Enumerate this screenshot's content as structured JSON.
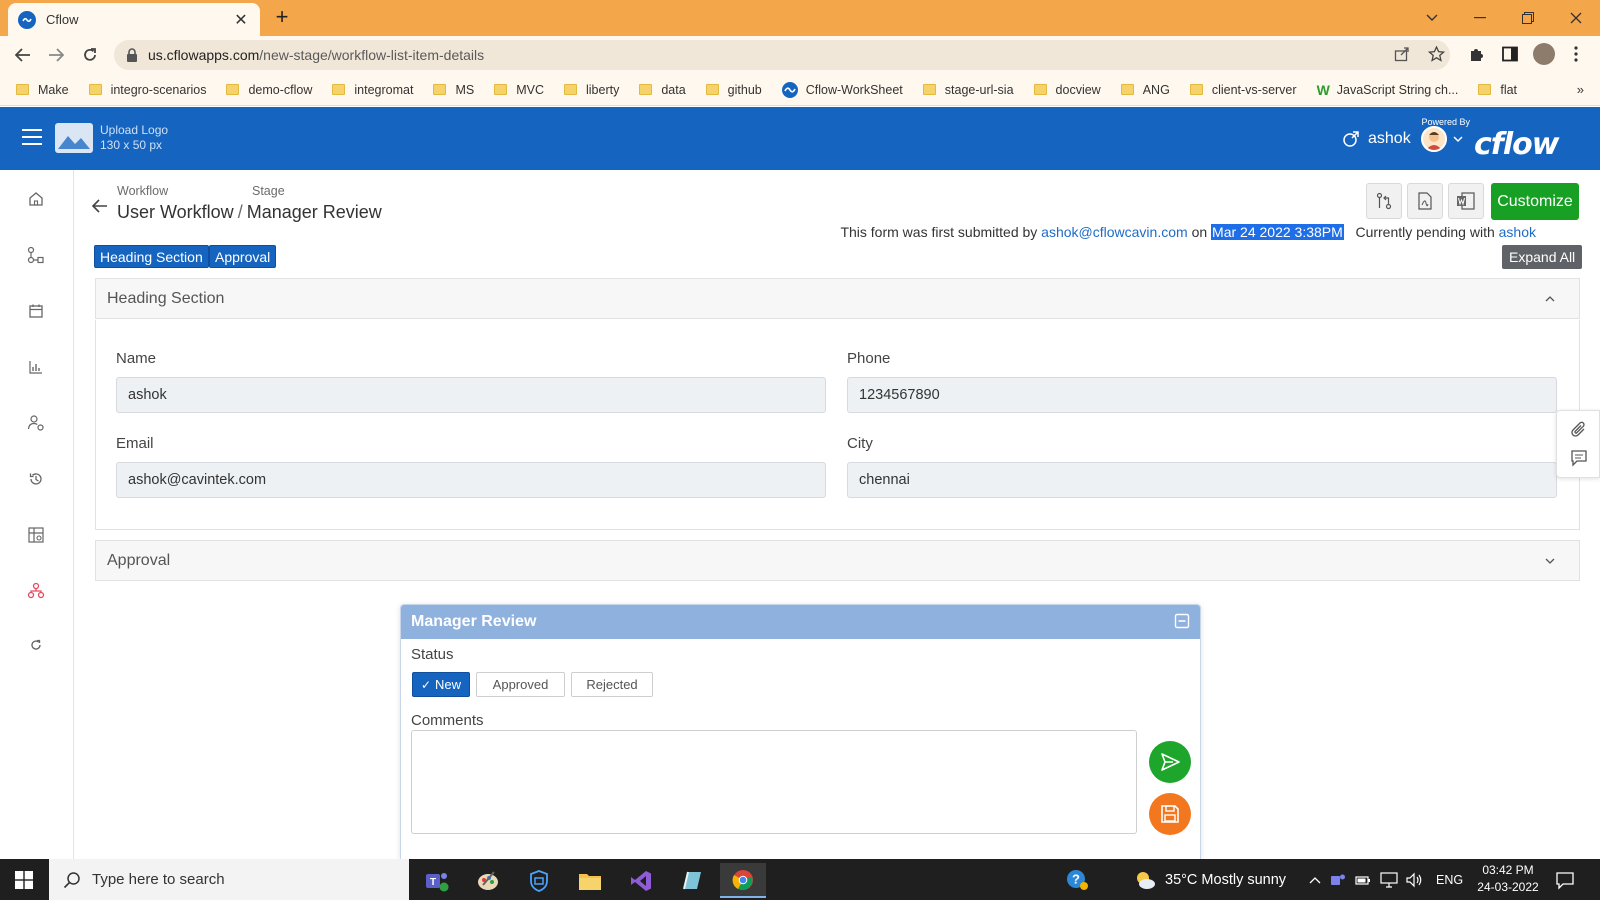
{
  "browser": {
    "tab_title": "Cflow",
    "url_host": "us.cflowapps.com",
    "url_path": "/new-stage/workflow-list-item-details",
    "bookmarks": [
      "Make",
      "integro-scenarios",
      "demo-cflow",
      "integromat",
      "MS",
      "MVC",
      "liberty",
      "data",
      "github",
      "Cflow-WorkSheet",
      "stage-url-sia",
      "docview",
      "ANG",
      "client-vs-server",
      "JavaScript String ch...",
      "flat"
    ],
    "bookmarks_more": "»"
  },
  "app": {
    "logo_line1": "Upload Logo",
    "logo_line2": "130 x 50 px",
    "user_name": "ashok",
    "powered_by": "Powered By",
    "brand": "cflow",
    "brand_color": "#1565c0"
  },
  "breadcrumb": {
    "workflow_label": "Workflow",
    "stage_label": "Stage",
    "workflow_name": "User Workflow",
    "separator": "/",
    "stage_name": "Manager Review"
  },
  "actions": {
    "customize_label": "Customize",
    "customize_color": "#18a025"
  },
  "submission": {
    "prefix": "This form was first submitted by",
    "email": "ashok@cflowcavin.com",
    "on": "on",
    "date": "Mar 24 2022 3:38PM",
    "pending_text": "Currently pending with",
    "pending_user": "ashok"
  },
  "sections": {
    "chips": [
      "Heading Section",
      "Approval"
    ],
    "expand_all": "Expand All",
    "heading_title": "Heading Section",
    "approval_title": "Approval"
  },
  "form": {
    "name_label": "Name",
    "name_value": "ashok",
    "phone_label": "Phone",
    "phone_value": "1234567890",
    "email_label": "Email",
    "email_value": "ashok@cavintek.com",
    "city_label": "City",
    "city_value": "chennai"
  },
  "review": {
    "title": "Manager Review",
    "status_label": "Status",
    "status_options": [
      "New",
      "Approved",
      "Rejected"
    ],
    "status_selected": "New",
    "comments_label": "Comments",
    "comments_value": "",
    "send_color": "#1ea52b",
    "save_color": "#f2771e"
  },
  "taskbar": {
    "search_placeholder": "Type here to search",
    "weather": "35°C  Mostly sunny",
    "language": "ENG",
    "time": "03:42 PM",
    "date": "24-03-2022"
  }
}
